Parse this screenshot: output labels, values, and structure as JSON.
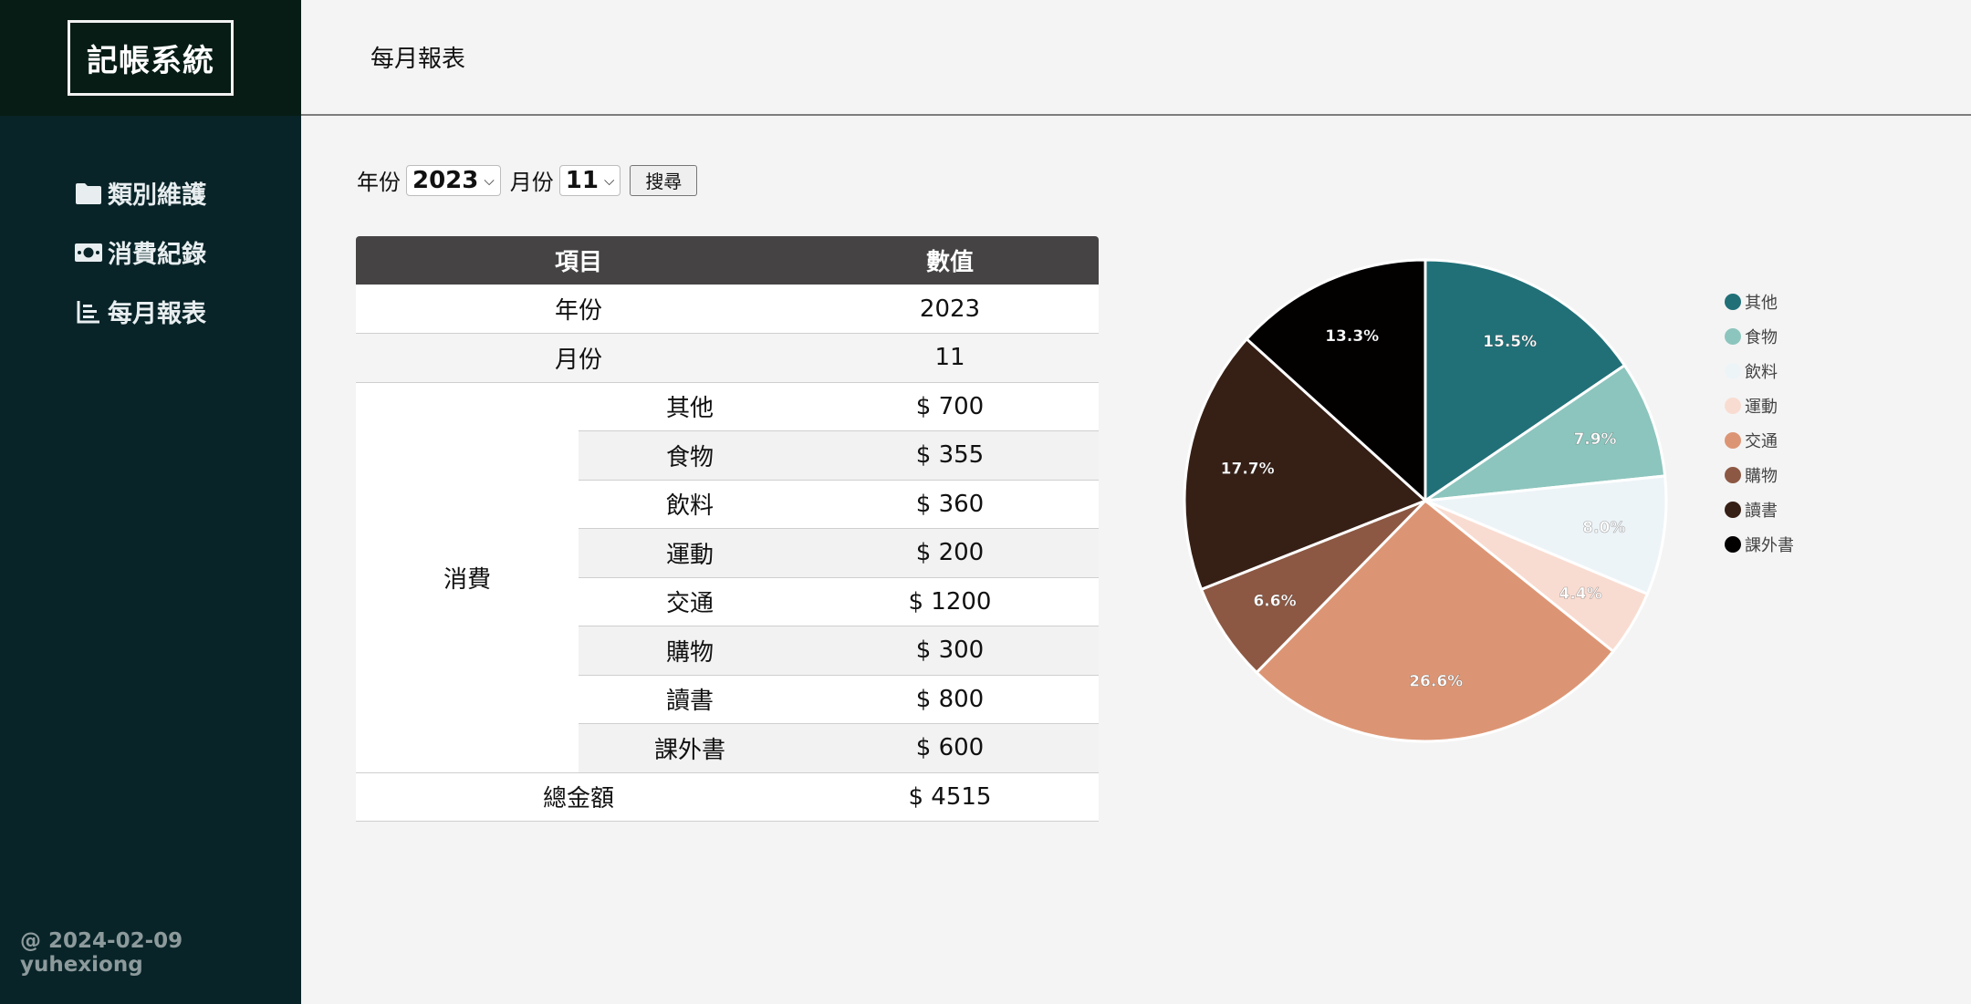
{
  "app": {
    "brand": "記帳系統"
  },
  "sidebar": {
    "items": [
      {
        "label": "類別維護",
        "icon": "folder-icon"
      },
      {
        "label": "消費紀錄",
        "icon": "money-icon"
      },
      {
        "label": "每月報表",
        "icon": "chart-icon"
      }
    ],
    "footer": "@ 2024-02-09 yuhexiong"
  },
  "header": {
    "title": "每月報表"
  },
  "filter": {
    "year_label": "年份",
    "year_value": "2023",
    "month_label": "月份",
    "month_value": "11",
    "search_label": "搜尋"
  },
  "table": {
    "headers": [
      "項目",
      "數值"
    ],
    "year_row": {
      "label": "年份",
      "value": "2023"
    },
    "month_row": {
      "label": "月份",
      "value": "11"
    },
    "group_label": "消費",
    "rows": [
      {
        "name": "其他",
        "value": "$ 700"
      },
      {
        "name": "食物",
        "value": "$ 355"
      },
      {
        "name": "飲料",
        "value": "$ 360"
      },
      {
        "name": "運動",
        "value": "$ 200"
      },
      {
        "name": "交通",
        "value": "$ 1200"
      },
      {
        "name": "購物",
        "value": "$ 300"
      },
      {
        "name": "讀書",
        "value": "$ 800"
      },
      {
        "name": "課外書",
        "value": "$ 600"
      }
    ],
    "total": {
      "label": "總金額",
      "value": "$ 4515"
    }
  },
  "chart_data": {
    "type": "pie",
    "categories": [
      "其他",
      "食物",
      "飲料",
      "運動",
      "交通",
      "購物",
      "讀書",
      "課外書"
    ],
    "values": [
      700,
      355,
      360,
      200,
      1200,
      300,
      800,
      600
    ],
    "labels": [
      "15.5%",
      "7.9%",
      "8.0%",
      "4.4%",
      "26.6%",
      "6.6%",
      "17.7%",
      "13.3%"
    ],
    "colors": [
      "#217078",
      "#8cc5bd",
      "#edf4f8",
      "#f9dcd1",
      "#dc9574",
      "#8c5843",
      "#361f15",
      "#030000"
    ],
    "legend_position": "right"
  }
}
